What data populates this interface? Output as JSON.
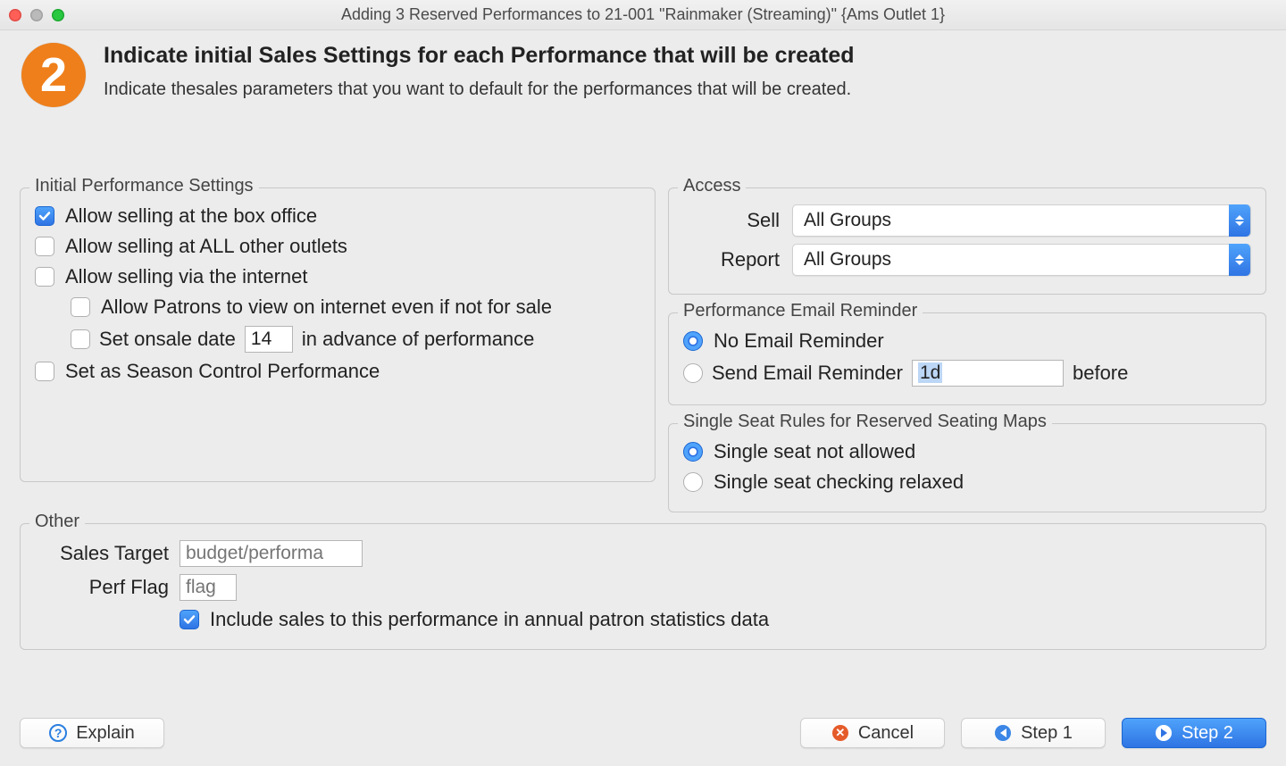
{
  "window": {
    "title": "Adding 3 Reserved Performances to 21-001 \"Rainmaker (Streaming)\" {Ams Outlet 1}"
  },
  "header": {
    "step_number": "2",
    "title": "Indicate initial Sales Settings for each Performance that will be created",
    "subtitle": "Indicate thesales parameters that you want to default for the performances that will be created."
  },
  "settings": {
    "legend": "Initial Performance Settings",
    "allow_box_office": {
      "label": "Allow selling at the box office",
      "checked": true
    },
    "allow_other_outlets": {
      "label": "Allow selling at ALL other outlets",
      "checked": false
    },
    "allow_internet": {
      "label": "Allow selling via the internet",
      "checked": false
    },
    "allow_view_internet": {
      "label": "Allow Patrons to view on internet even if not for sale",
      "checked": false
    },
    "set_onsale_date": {
      "label_before": "Set onsale date",
      "value": "14",
      "label_after": "in advance of performance",
      "checked": false
    },
    "season_control": {
      "label": "Set as Season Control Performance",
      "checked": false
    }
  },
  "access": {
    "legend": "Access",
    "sell": {
      "label": "Sell",
      "value": "All Groups"
    },
    "report": {
      "label": "Report",
      "value": "All Groups"
    }
  },
  "reminder": {
    "legend": "Performance Email Reminder",
    "none": {
      "label": "No Email Reminder",
      "checked": true
    },
    "send": {
      "label": "Send Email Reminder",
      "checked": false,
      "value": "1d",
      "after": "before"
    }
  },
  "single_seat": {
    "legend": "Single Seat Rules for Reserved Seating Maps",
    "not_allowed": {
      "label": "Single seat not allowed",
      "checked": true
    },
    "relaxed": {
      "label": "Single seat checking relaxed",
      "checked": false
    }
  },
  "other": {
    "legend": "Other",
    "sales_target": {
      "label": "Sales Target",
      "placeholder": "budget/performa"
    },
    "perf_flag": {
      "label": "Perf Flag",
      "placeholder": "flag"
    },
    "include_stats": {
      "label": "Include sales to this performance in annual patron statistics data",
      "checked": true
    }
  },
  "footer": {
    "explain": "Explain",
    "cancel": "Cancel",
    "step1": "Step 1",
    "step2": "Step 2"
  }
}
